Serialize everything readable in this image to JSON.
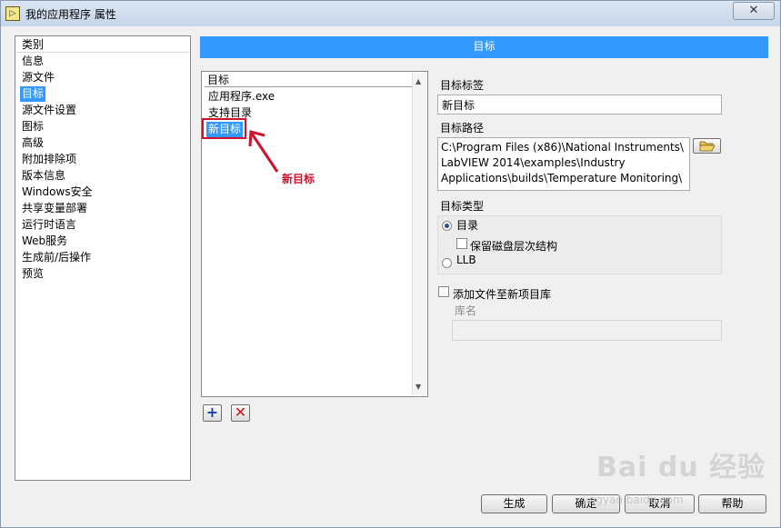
{
  "window": {
    "title": "我的应用程序 属性",
    "app_icon_text": "▷",
    "close_label": "✕"
  },
  "categories": {
    "header": "类别",
    "items": [
      "信息",
      "源文件",
      "目标",
      "源文件设置",
      "图标",
      "高级",
      "附加排除项",
      "版本信息",
      "Windows安全",
      "共享变量部署",
      "运行时语言",
      "Web服务",
      "生成前/后操作",
      "预览"
    ],
    "selected_index": 2
  },
  "panel": {
    "title": "目标"
  },
  "target_list": {
    "header": "目标",
    "items": [
      "应用程序.exe",
      "支持目录",
      "新目标"
    ],
    "selected_index": 2
  },
  "annotation": {
    "text": "新目标",
    "color": "#d0102c"
  },
  "list_buttons": {
    "add_icon": "plus-icon",
    "delete_icon": "x-icon"
  },
  "form": {
    "target_label_title": "目标标签",
    "target_label_value": "新目标",
    "target_path_title": "目标路径",
    "target_path_lines": [
      "C:\\Program Files (x86)\\National Instruments\\",
      "LabVIEW 2014\\examples\\Industry",
      "Applications\\builds\\Temperature Monitoring\\"
    ],
    "target_type_title": "目标类型",
    "type_options": [
      "目录",
      "LLB"
    ],
    "selected_type": "目录",
    "preserve_hierarchy_label": "保留磁盘层次结构",
    "preserve_hierarchy_checked": false,
    "add_to_library_label": "添加文件至新项目库",
    "add_to_library_checked": false,
    "library_name_label": "库名",
    "library_name_value": ""
  },
  "buttons": {
    "build": "生成",
    "ok": "确定",
    "cancel": "取消",
    "help": "帮助"
  },
  "watermark": {
    "text": "Bai du 经验",
    "url": "jingyan.baidu.com"
  },
  "colors": {
    "selection": "#3399ff",
    "header_bar": "#3399ff",
    "annotation_red": "#d0102c"
  }
}
